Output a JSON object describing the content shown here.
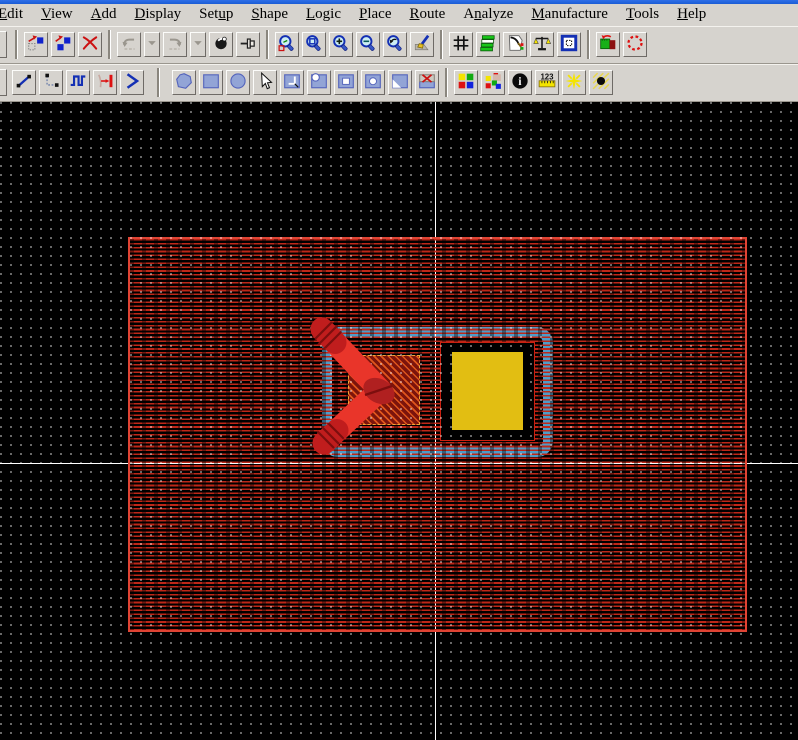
{
  "window": {
    "chrome_bg": "#d6d3ce",
    "titlebar_color": "#1b5cd5"
  },
  "menu_bar": {
    "items": [
      {
        "label": "Edit",
        "underline": 0
      },
      {
        "label": "View",
        "underline": 0
      },
      {
        "label": "Add",
        "underline": 0
      },
      {
        "label": "Display",
        "underline": 0
      },
      {
        "label": "Setup",
        "underline": 3
      },
      {
        "label": "Shape",
        "underline": 0
      },
      {
        "label": "Logic",
        "underline": 0
      },
      {
        "label": "Place",
        "underline": 0
      },
      {
        "label": "Route",
        "underline": 0
      },
      {
        "label": "Analyze",
        "underline": 1
      },
      {
        "label": "Manufacture",
        "underline": 0
      },
      {
        "label": "Tools",
        "underline": 0
      },
      {
        "label": "Help",
        "underline": 0
      }
    ]
  },
  "toolbar_row1": {
    "items": [
      {
        "kind": "sliver"
      },
      {
        "kind": "separator"
      },
      {
        "kind": "button",
        "name": "move",
        "icon": "move-icon",
        "enabled": true
      },
      {
        "kind": "button",
        "name": "copy",
        "icon": "copy-icon",
        "enabled": true
      },
      {
        "kind": "button",
        "name": "delete",
        "icon": "delete-icon",
        "enabled": true
      },
      {
        "kind": "separator"
      },
      {
        "kind": "button",
        "name": "undo",
        "icon": "undo-icon",
        "enabled": false
      },
      {
        "kind": "button",
        "name": "undo-options",
        "icon": "dropdown-icon",
        "enabled": false,
        "narrow": true
      },
      {
        "kind": "button",
        "name": "redo",
        "icon": "redo-icon",
        "enabled": false
      },
      {
        "kind": "button",
        "name": "redo-options",
        "icon": "dropdown-icon",
        "enabled": false,
        "narrow": true
      },
      {
        "kind": "button",
        "name": "glue",
        "icon": "glue-icon",
        "enabled": true
      },
      {
        "kind": "button",
        "name": "pin",
        "icon": "pin-icon",
        "enabled": true
      },
      {
        "kind": "separator"
      },
      {
        "kind": "button",
        "name": "zoom-points",
        "icon": "zoom-points-icon",
        "enabled": true
      },
      {
        "kind": "button",
        "name": "zoom-fit",
        "icon": "zoom-fit-icon",
        "enabled": true
      },
      {
        "kind": "button",
        "name": "zoom-in",
        "icon": "zoom-in-icon",
        "enabled": true
      },
      {
        "kind": "button",
        "name": "zoom-out",
        "icon": "zoom-out-icon",
        "enabled": true
      },
      {
        "kind": "button",
        "name": "zoom-previous",
        "icon": "zoom-previous-icon",
        "enabled": true
      },
      {
        "kind": "button",
        "name": "redraw",
        "icon": "redraw-icon",
        "enabled": true
      },
      {
        "kind": "separator"
      },
      {
        "kind": "button",
        "name": "grid-toggle",
        "icon": "grid-icon",
        "enabled": true
      },
      {
        "kind": "button",
        "name": "cross-section",
        "icon": "xsection-icon",
        "enabled": true
      },
      {
        "kind": "button",
        "name": "color-visibility",
        "icon": "color-visibility-icon",
        "enabled": true
      },
      {
        "kind": "button",
        "name": "constraint-manager",
        "icon": "constraints-icon",
        "enabled": true
      },
      {
        "kind": "button",
        "name": "shape-check",
        "icon": "shape-check-icon",
        "enabled": true
      },
      {
        "kind": "separator"
      },
      {
        "kind": "button",
        "name": "place-component",
        "icon": "place-component-icon",
        "enabled": true
      },
      {
        "kind": "button",
        "name": "unplace-component",
        "icon": "unplace-component-icon",
        "enabled": true
      }
    ]
  },
  "toolbar_row2": {
    "items": [
      {
        "kind": "sliver"
      },
      {
        "kind": "button",
        "name": "add-connect",
        "icon": "add-connect-icon",
        "enabled": true
      },
      {
        "kind": "button",
        "name": "slide",
        "icon": "slide-icon",
        "enabled": true
      },
      {
        "kind": "button",
        "name": "custom-route",
        "icon": "custom-route-icon",
        "enabled": true
      },
      {
        "kind": "button",
        "name": "create-fanout",
        "icon": "fanout-icon",
        "enabled": true
      },
      {
        "kind": "button",
        "name": "vertex",
        "icon": "vertex-icon",
        "enabled": true
      },
      {
        "kind": "separator-big"
      },
      {
        "kind": "button",
        "name": "shape-add-polygon",
        "icon": "shape-polygon-icon",
        "enabled": true
      },
      {
        "kind": "button",
        "name": "shape-add-rect",
        "icon": "shape-rect-icon",
        "enabled": true
      },
      {
        "kind": "button",
        "name": "shape-add-circle",
        "icon": "shape-circle-icon",
        "enabled": true
      },
      {
        "kind": "button",
        "name": "shape-select",
        "icon": "select-shape-icon",
        "enabled": true
      },
      {
        "kind": "button",
        "name": "shape-edit-boundary",
        "icon": "shape-edit-boundary-icon",
        "enabled": true
      },
      {
        "kind": "button",
        "name": "shape-merge",
        "icon": "shape-notch-icon",
        "enabled": true
      },
      {
        "kind": "button",
        "name": "void-rect",
        "icon": "void-rect-icon",
        "enabled": true
      },
      {
        "kind": "button",
        "name": "void-circle",
        "icon": "void-circle-icon",
        "enabled": true
      },
      {
        "kind": "button",
        "name": "void-polygon",
        "icon": "void-polygon-icon",
        "enabled": true
      },
      {
        "kind": "button",
        "name": "void-delete",
        "icon": "void-delete-icon",
        "enabled": true
      },
      {
        "kind": "separator"
      },
      {
        "kind": "button",
        "name": "color-priority",
        "icon": "color-priority-icon",
        "enabled": true
      },
      {
        "kind": "button",
        "name": "assign-color",
        "icon": "assign-color-icon",
        "enabled": true
      },
      {
        "kind": "button",
        "name": "show-element",
        "icon": "info-icon",
        "enabled": true
      },
      {
        "kind": "button",
        "name": "measure",
        "icon": "measure-icon",
        "enabled": true
      },
      {
        "kind": "button",
        "name": "highlight",
        "icon": "highlight-icon",
        "enabled": true
      },
      {
        "kind": "button",
        "name": "dehighlight",
        "icon": "dehighlight-icon",
        "enabled": true
      }
    ]
  },
  "canvas": {
    "background": "#000000",
    "grid_dot_color": "#ffffff",
    "crosshair_color": "#ffffff",
    "shapes": {
      "copper_pour": {
        "hatch_color": "#bf2718",
        "border_color": "#e04434"
      },
      "keepin_ring": {
        "color": "#4d9cc9"
      },
      "pad_void": {
        "fill": "#000000",
        "border_color": "#cc2010"
      },
      "yellow_pad": {
        "fill": "#e2be12"
      },
      "hatched_pad": {
        "line_color": "#e0561c",
        "bg_color": "#7c140c",
        "border_color": "#f0a838"
      },
      "connection_cluster": {
        "color": "#e9352a",
        "cap_color": "#c01d1d",
        "vertex_color": "#b02020",
        "hatch_color": "#7c0e0e"
      }
    }
  }
}
